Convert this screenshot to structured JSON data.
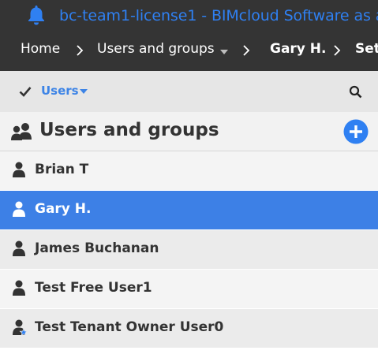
{
  "window": {
    "title": "bc-team1-license1 - BIMcloud Software as a",
    "bell_icon": "bell-icon"
  },
  "breadcrumb": {
    "items": [
      "Home",
      "Users and groups",
      "Gary H.",
      "Set"
    ]
  },
  "toolbar": {
    "filter_label": "Users",
    "check_icon": "check-icon",
    "search_icon": "search-icon"
  },
  "section": {
    "heading": "Users and groups",
    "add_icon": "plus-circle-icon"
  },
  "users": [
    {
      "name": "Brian T",
      "selected": false,
      "owner": false
    },
    {
      "name": "Gary H.",
      "selected": true,
      "owner": false
    },
    {
      "name": "James Buchanan",
      "selected": false,
      "owner": false
    },
    {
      "name": "Test Free User1",
      "selected": false,
      "owner": false
    },
    {
      "name": "Test Tenant Owner User0",
      "selected": false,
      "owner": true
    }
  ],
  "colors": {
    "accent": "#3d80e6",
    "title_blue": "#2f80f2",
    "header_bg": "#343434"
  }
}
